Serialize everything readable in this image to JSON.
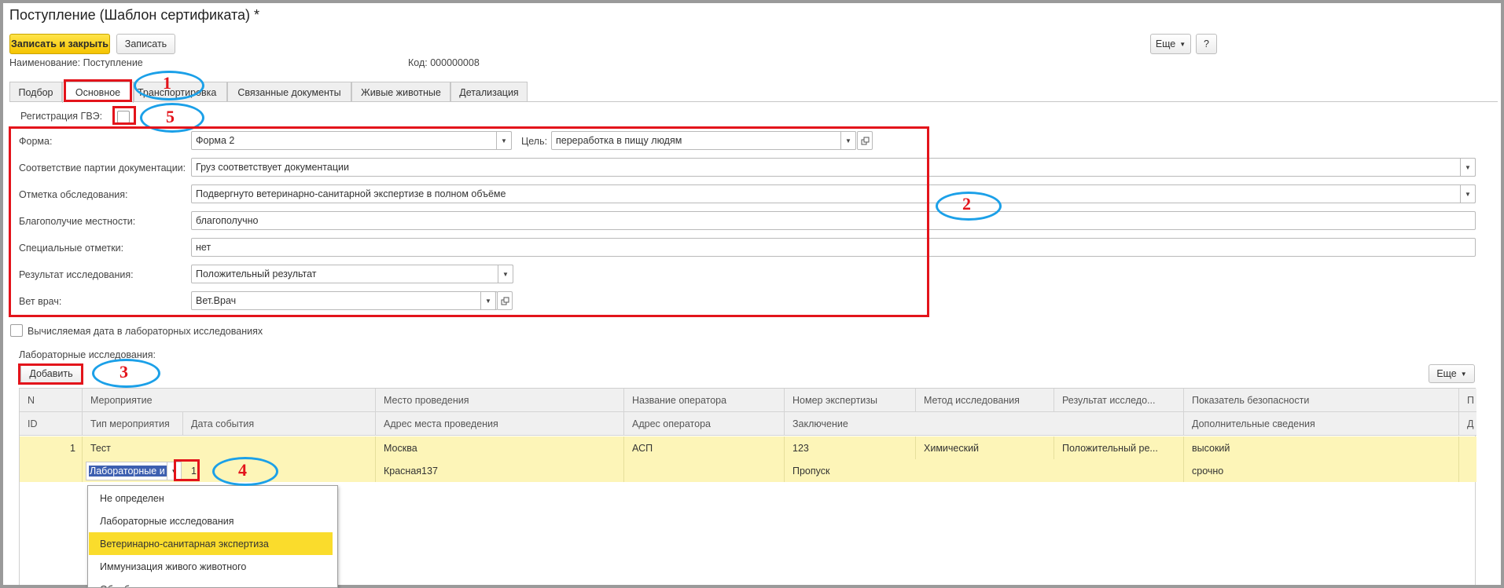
{
  "window": {
    "title": "Поступление (Шаблон сертификата) *"
  },
  "toolbar": {
    "save_close_label": "Записать и закрыть",
    "save_label": "Записать",
    "more_label": "Еще",
    "help_label": "?"
  },
  "header": {
    "name_label": "Наименование:",
    "name_value": "Поступление",
    "code_label": "Код:",
    "code_value": "000000008"
  },
  "tabs": [
    {
      "label": "Подбор"
    },
    {
      "label": "Основное"
    },
    {
      "label": "Транспортировка"
    },
    {
      "label": "Связанные документы"
    },
    {
      "label": "Живые животные"
    },
    {
      "label": "Детализация"
    }
  ],
  "gve": {
    "label": "Регистрация ГВЭ:"
  },
  "form": {
    "forma": {
      "label": "Форма:",
      "value": "Форма 2"
    },
    "purpose": {
      "label": "Цель:",
      "value": "переработка в пищу людям"
    },
    "compliance": {
      "label": "Соответствие партии документации:",
      "value": "Груз соответствует документации"
    },
    "inspection": {
      "label": "Отметка обследования:",
      "value": "Подвергнуто ветеринарно-санитарной экспертизе в полном объёме"
    },
    "locality": {
      "label": "Благополучие местности:",
      "value": "благополучно"
    },
    "special": {
      "label": "Специальные отметки:",
      "value": "нет"
    },
    "result": {
      "label": "Результат исследования:",
      "value": "Положительный результат"
    },
    "vet": {
      "label": "Вет врач:",
      "value": "Вет.Врач"
    }
  },
  "computed_date": {
    "label": "Вычисляемая дата в лабораторных исследованиях"
  },
  "lab": {
    "title": "Лабораторные исследования:",
    "add_label": "Добавить",
    "more_label": "Еще",
    "header_row1": [
      "N",
      "Мероприятие",
      "Место проведения",
      "Название оператора",
      "Номер экспертизы",
      "Метод исследования",
      "Результат исследо...",
      "Показатель безопасности",
      "П"
    ],
    "header_row2": [
      "ID",
      "Тип мероприятия",
      "Дата события",
      "Адрес места проведения",
      "Адрес оператора",
      "Заключение",
      "Дополнительные сведения",
      "Д"
    ],
    "row1": [
      "1",
      "Тест",
      "Москва",
      "АСП",
      "123",
      "Химический",
      "Положительный ре...",
      "высокий"
    ],
    "row2": {
      "type_value": "Лабораторные и",
      "date_partial": "1",
      "address": "Красная137",
      "conclusion": "Пропуск",
      "additional": "срочно"
    }
  },
  "dropdown": {
    "items": [
      "Не определен",
      "Лабораторные исследования",
      "Ветеринарно-санитарная экспертиза",
      "Иммунизация живого животного",
      "Обработка"
    ],
    "highlighted": 2
  },
  "annotations": {
    "n1": "1",
    "n2": "2",
    "n3": "3",
    "n4": "4",
    "n5": "5"
  },
  "colors": {
    "accent_yellow": "#f5c400",
    "row_highlight": "#fdf5b8",
    "annotation_red": "#e3141b",
    "annotation_blue": "#1ba0e8"
  }
}
